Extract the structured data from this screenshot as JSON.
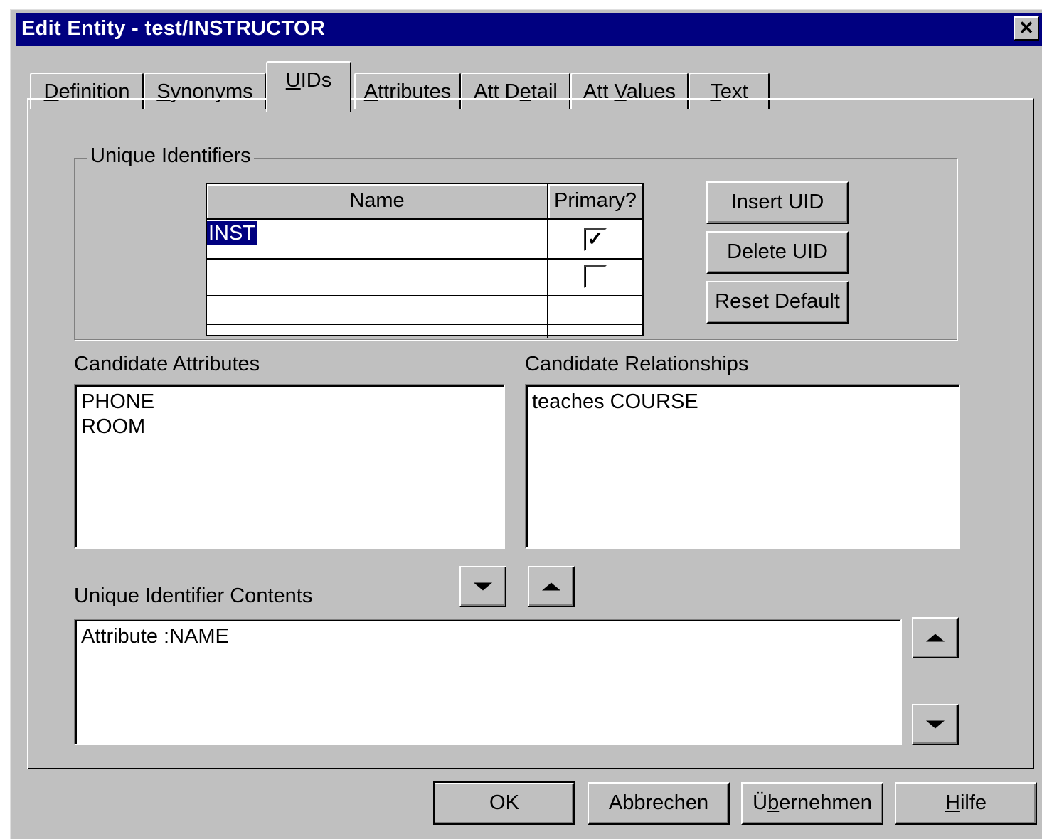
{
  "window": {
    "title": "Edit Entity - test/INSTRUCTOR",
    "close_glyph": "✕"
  },
  "tabs": [
    {
      "pre": "",
      "key": "D",
      "post": "efinition"
    },
    {
      "pre": "",
      "key": "S",
      "post": "ynonyms"
    },
    {
      "pre": "",
      "key": "U",
      "post": "IDs"
    },
    {
      "pre": "",
      "key": "A",
      "post": "ttributes"
    },
    {
      "pre": "Att D",
      "key": "e",
      "post": "tail"
    },
    {
      "pre": "Att ",
      "key": "V",
      "post": "alues"
    },
    {
      "pre": "",
      "key": "T",
      "post": "ext"
    }
  ],
  "active_tab": "UIDs",
  "unique_identifiers": {
    "group_label": "Unique Identifiers",
    "columns": {
      "name": "Name",
      "primary": "Primary?"
    },
    "rows": [
      {
        "name": "INST",
        "primary": true
      },
      {
        "name": "",
        "primary": false
      }
    ],
    "check_glyph": "✓",
    "insert_label": "Insert UID",
    "delete_label": "Delete UID",
    "reset_label": "Reset Default"
  },
  "candidate_attributes": {
    "label": "Candidate Attributes",
    "items": [
      "PHONE",
      "ROOM"
    ]
  },
  "candidate_relationships": {
    "label": "Candidate Relationships",
    "items": [
      "teaches COURSE"
    ]
  },
  "uid_contents": {
    "label": "Unique Identifier Contents",
    "items": [
      "Attribute :NAME"
    ]
  },
  "footer": {
    "ok_label": "OK",
    "cancel_label": "Abbrechen",
    "apply_pre": "Ü",
    "apply_key": "b",
    "apply_post": "ernehmen",
    "help_key": "H",
    "help_post": "ilfe"
  }
}
